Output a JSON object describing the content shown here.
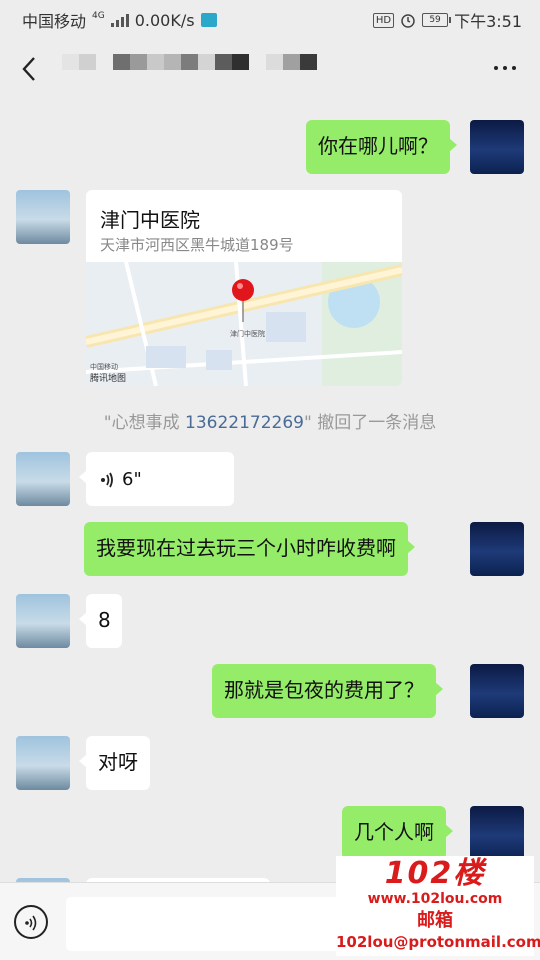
{
  "status_bar": {
    "carrier": "中国移动",
    "network": "4G",
    "speed": "0.00K/s",
    "hd": "HD",
    "battery": "59",
    "time": "下午3:51"
  },
  "header": {
    "back_icon": "chevron-left-icon",
    "more_icon": "more-dots-icon"
  },
  "messages": [
    {
      "side": "me",
      "text": "你在哪儿啊？"
    },
    {
      "side": "other",
      "type": "location",
      "name": "津门中医院",
      "address": "天津市河西区黑牛城道189号",
      "map_label": "津门中医院",
      "map_brand": "腾讯地图",
      "map_source": "中国移动"
    },
    {
      "side": "system",
      "prefix": "\"心想事成 ",
      "number": "13622172269",
      "suffix": "\" 撤回了一条消息"
    },
    {
      "side": "other",
      "type": "voice",
      "duration": "6\""
    },
    {
      "side": "me",
      "text": "我要现在过去玩三个小时咋收费啊"
    },
    {
      "side": "other",
      "text": "8"
    },
    {
      "side": "me",
      "text": "那就是包夜的费用了？"
    },
    {
      "side": "other",
      "text": "对呀"
    },
    {
      "side": "me",
      "text": "几个人啊"
    }
  ],
  "watermark": {
    "logo": "102楼",
    "url": "www.102lou.com",
    "label": "邮箱",
    "email": "102lou@protonmail.com"
  }
}
